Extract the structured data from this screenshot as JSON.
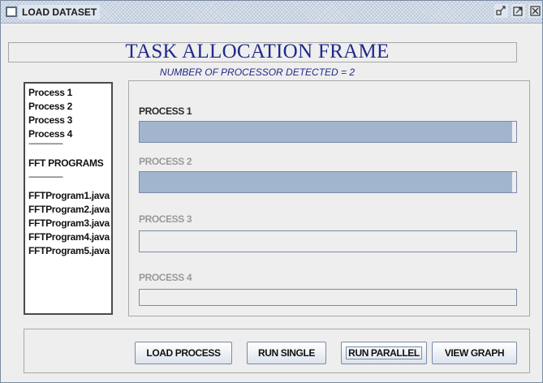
{
  "window": {
    "title": "LOAD DATASET",
    "controls": [
      "minimize-icon",
      "maximize-icon",
      "close-icon"
    ]
  },
  "header": {
    "title": "TASK ALLOCATION FRAME",
    "subtitle": "NUMBER OF PROCESSOR DETECTED = 2"
  },
  "sidebar": {
    "processes": [
      "Process 1",
      "Process 2",
      "Process 3",
      "Process 4"
    ],
    "separator": "------------------",
    "section_label": "FFT PROGRAMS",
    "programs": [
      "FFTProgram1.java",
      "FFTProgram2.java",
      "FFTProgram3.java",
      "FFTProgram4.java",
      "FFTProgram5.java"
    ]
  },
  "processes": [
    {
      "label": "PROCESS 1",
      "state": "active",
      "progress": 0.99
    },
    {
      "label": "PROCESS 2",
      "state": "dim",
      "progress": 0.99
    },
    {
      "label": "PROCESS 3",
      "state": "dim",
      "progress": 0
    },
    {
      "label": "PROCESS 4",
      "state": "dim",
      "progress": 0
    }
  ],
  "toolbar": {
    "load_label": "LOAD PROCESS",
    "run_single_label": "RUN SINGLE",
    "run_parallel_label": "RUN PARALLEL",
    "view_graph_label": "VIEW GRAPH"
  },
  "colors": {
    "title_text": "#1f2a8a",
    "progress_fill": "#a2b5cf",
    "progress_border": "#7a8aa8"
  }
}
